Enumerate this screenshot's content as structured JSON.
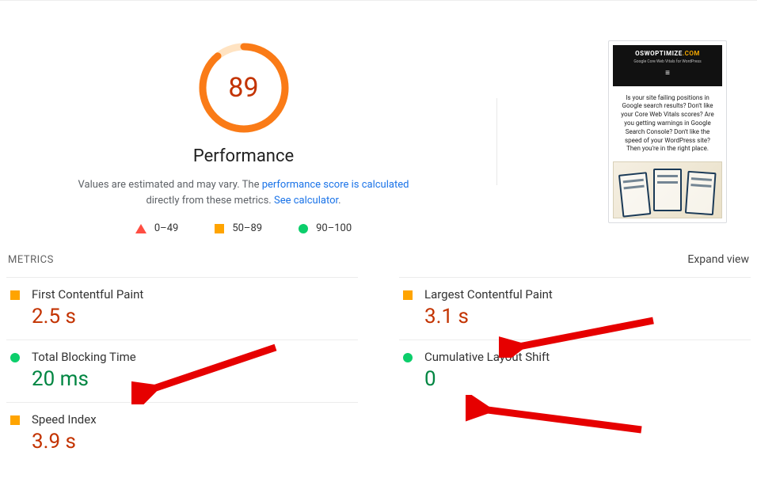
{
  "gauge": {
    "score": "89",
    "title": "Performance",
    "desc_prefix": "Values are estimated and may vary. The ",
    "desc_link1": "performance score is calculated",
    "desc_mid": " directly from these metrics. ",
    "desc_link2": "See calculator",
    "desc_suffix": "."
  },
  "legend": {
    "r1": "0–49",
    "r2": "50–89",
    "r3": "90–100"
  },
  "preview": {
    "brand_main": "OSWOPTIMIZE",
    "brand_dom": ".COM",
    "brand_sub": "Google Core Web Vitals for WordPress",
    "body": "Is your site failing positions in Google search results? Don't like your Core Web Vitals scores? Are you getting warnings in Google Search Console? Don't like the speed of your WordPress site? Then you're in the right place."
  },
  "metrics_header": {
    "label": "METRICS",
    "expand": "Expand view"
  },
  "metrics": [
    {
      "name": "First Contentful Paint",
      "value": "2.5 s",
      "status": "orange"
    },
    {
      "name": "Largest Contentful Paint",
      "value": "3.1 s",
      "status": "orange"
    },
    {
      "name": "Total Blocking Time",
      "value": "20 ms",
      "status": "green"
    },
    {
      "name": "Cumulative Layout Shift",
      "value": "0",
      "status": "green"
    },
    {
      "name": "Speed Index",
      "value": "3.9 s",
      "status": "orange"
    }
  ],
  "colors": {
    "orange": "#ffa400",
    "green": "#0cce6b",
    "red": "#ff4e42",
    "arrow": "#e60000"
  }
}
